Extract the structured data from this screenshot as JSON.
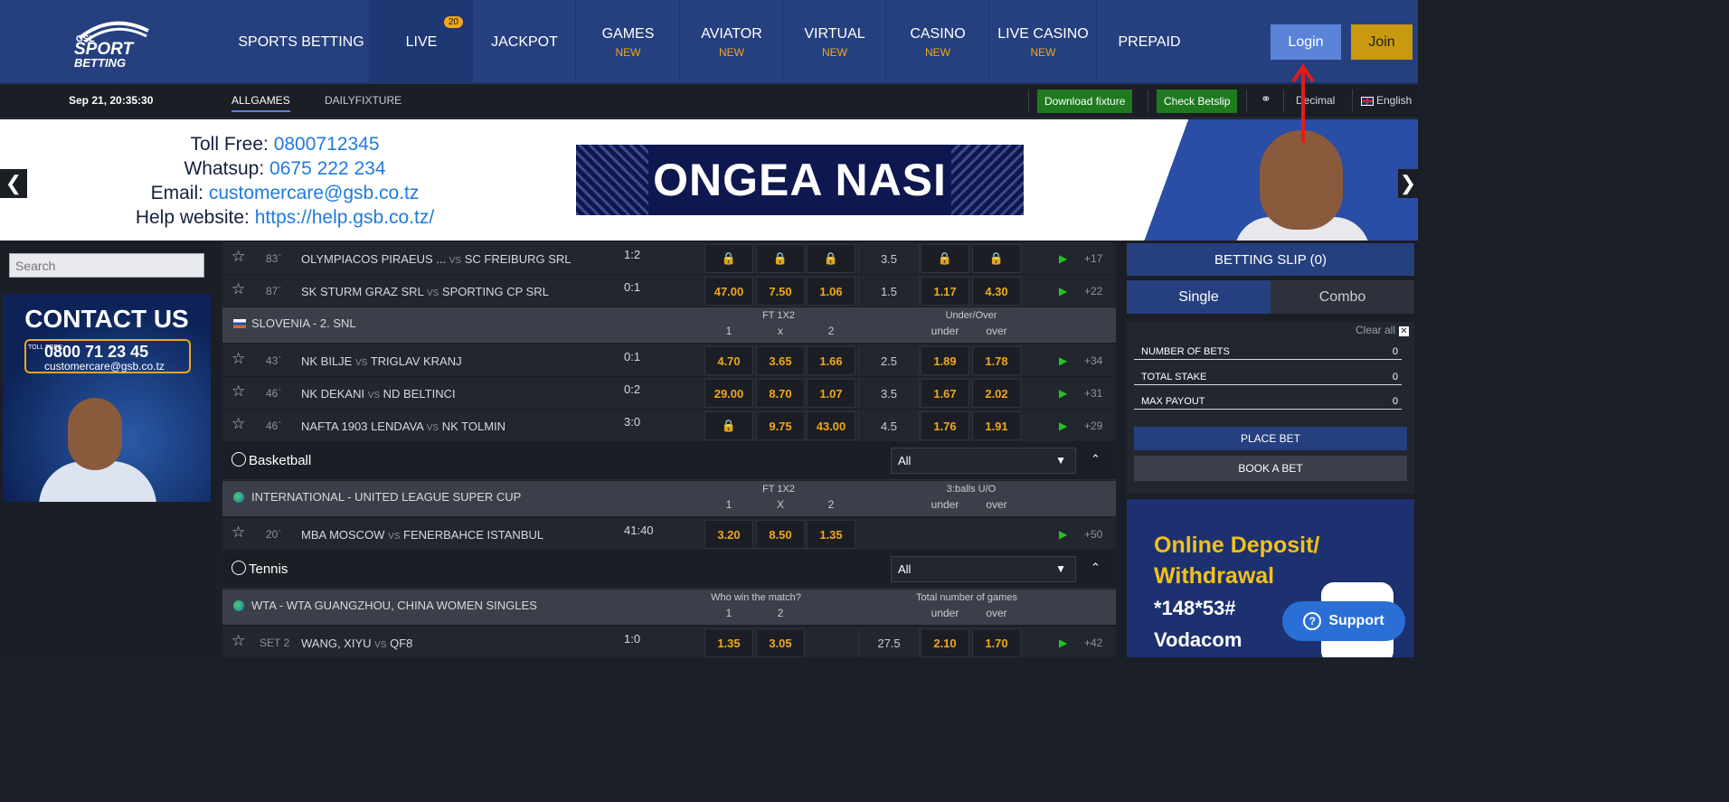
{
  "nav": {
    "logo_text_top": "GSL",
    "logo_text_mid": "SPORT",
    "logo_text_bot": "BETTING",
    "items": [
      {
        "label": "SPORTS BETTING",
        "sub": ""
      },
      {
        "label": "LIVE",
        "sub": "",
        "badge": "20"
      },
      {
        "label": "JACKPOT",
        "sub": ""
      },
      {
        "label": "GAMES",
        "sub": "NEW"
      },
      {
        "label": "AVIATOR",
        "sub": "NEW"
      },
      {
        "label": "VIRTUAL",
        "sub": "NEW"
      },
      {
        "label": "CASINO",
        "sub": "NEW"
      },
      {
        "label": "LIVE CASINO",
        "sub": "NEW"
      },
      {
        "label": "PREPAID",
        "sub": ""
      }
    ],
    "login": "Login",
    "join": "Join"
  },
  "subbar": {
    "datetime": "Sep 21, 20:35:30",
    "tab_all": "ALLGAMES",
    "tab_daily": "DAILYFIXTURE",
    "download": "Download fixture",
    "check": "Check Betslip",
    "odds_format": "Decimal",
    "language": "English"
  },
  "banner": {
    "toll_label": "Toll Free:",
    "toll_value": "0800712345",
    "whatsup_label": "Whatsup:",
    "whatsup_value": "0675 222 234",
    "email_label": "Email:",
    "email_value": "customercare@gsb.co.tz",
    "help_label": "Help website:",
    "help_value": "https://help.gsb.co.tz/",
    "slogan": "ONGEA NASI"
  },
  "left": {
    "search_placeholder": "Search",
    "ad_title": "CONTACT US",
    "ad_toll": "TOLL FREE:",
    "ad_phone": "0800 71 23 45",
    "ad_email": "customercare@gsb.co.tz"
  },
  "matches": {
    "row1": {
      "min": "83`",
      "home": "OLYMPIACOS PIRAEUS ...",
      "away": "SC FREIBURG SRL",
      "score": "1:2",
      "line": "3.5",
      "more": "+17"
    },
    "row2": {
      "min": "87`",
      "home": "SK STURM GRAZ SRL",
      "away": "SPORTING CP SRL",
      "score": "0:1",
      "o1": "47.00",
      "ox": "7.50",
      "o2": "1.06",
      "line": "1.5",
      "under": "1.17",
      "over": "4.30",
      "more": "+22"
    },
    "league_slo": {
      "name": "SLOVENIA   - 2. SNL",
      "h_ft": "FT 1X2",
      "h_1": "1",
      "h_x": "x",
      "h_2": "2",
      "h_uo": "Under/Over",
      "h_under": "under",
      "h_over": "over"
    },
    "row3": {
      "min": "43`",
      "home": "NK BILJE",
      "away": "TRIGLAV KRANJ",
      "score": "0:1",
      "o1": "4.70",
      "ox": "3.65",
      "o2": "1.66",
      "line": "2.5",
      "under": "1.89",
      "over": "1.78",
      "more": "+34"
    },
    "row4": {
      "min": "46`",
      "home": "NK DEKANI",
      "away": "ND BELTINCI",
      "score": "0:2",
      "o1": "29.00",
      "ox": "8.70",
      "o2": "1.07",
      "line": "3.5",
      "under": "1.67",
      "over": "2.02",
      "more": "+31"
    },
    "row5": {
      "min": "46`",
      "home": "NAFTA 1903 LENDAVA",
      "away": "NK TOLMIN",
      "score": "3:0",
      "ox": "9.75",
      "o2": "43.00",
      "line": "4.5",
      "under": "1.76",
      "over": "1.91",
      "more": "+29"
    },
    "sport_bb": {
      "name": "Basketball",
      "select": "All"
    },
    "league_int": {
      "name": "INTERNATIONAL   - UNITED LEAGUE SUPER CUP",
      "h_ft": "FT 1X2",
      "h_1": "1",
      "h_x": "X",
      "h_2": "2",
      "h_uo": "3:balls U/O",
      "h_under": "under",
      "h_over": "over"
    },
    "row6": {
      "min": "20`",
      "home": "MBA MOSCOW",
      "away": "FENERBAHCE ISTANBUL",
      "score": "41:40",
      "o1": "3.20",
      "ox": "8.50",
      "o2": "1.35",
      "more": "+50"
    },
    "sport_tn": {
      "name": "Tennis",
      "select": "All"
    },
    "league_wta": {
      "name": "WTA   - WTA GUANGZHOU, CHINA WOMEN SINGLES",
      "h_ft": "Who win the match?",
      "h_1": "1",
      "h_2": "2",
      "h_uo": "Total number of games",
      "h_under": "under",
      "h_over": "over"
    },
    "row7": {
      "min": "SET 2",
      "home": "WANG, XIYU",
      "away": "QF8",
      "score": "1:0",
      "o1": "1.35",
      "o2": "3.05",
      "line": "27.5",
      "under": "2.10",
      "over": "1.70",
      "more": "+42"
    },
    "vs": "VS"
  },
  "slip": {
    "title": "BETTING SLIP (0)",
    "single": "Single",
    "combo": "Combo",
    "clear": "Clear all",
    "bets_label": "NUMBER OF BETS",
    "bets_value": "0",
    "stake_label": "TOTAL STAKE",
    "stake_value": "0",
    "payout_label": "MAX PAYOUT",
    "payout_value": "0",
    "place": "PLACE BET",
    "book": "BOOK A BET"
  },
  "deposit_ad": {
    "line1": "Online Deposit/",
    "line2": "Withdrawal",
    "code": "*148*53#",
    "provider": "Vodacom"
  },
  "support": "Support"
}
